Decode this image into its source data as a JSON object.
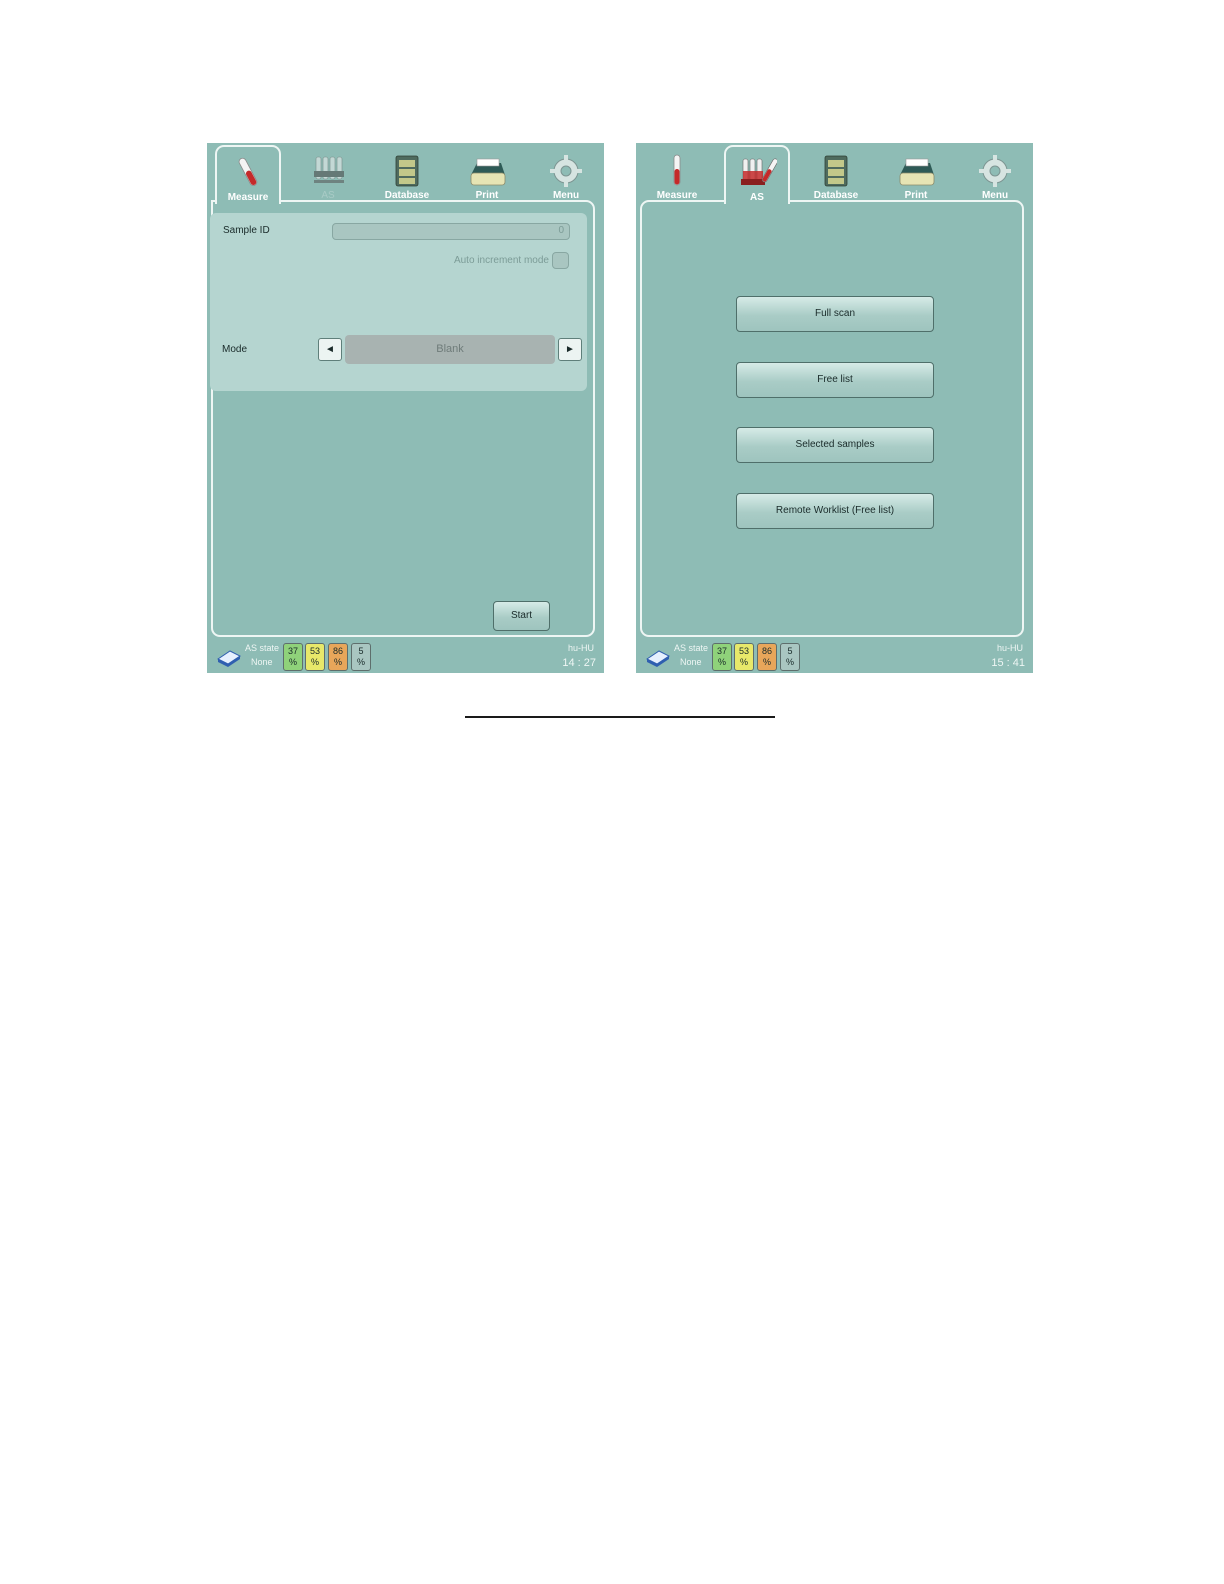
{
  "tabs": {
    "measure": "Measure",
    "as": "AS",
    "database": "Database",
    "print": "Print",
    "menu": "Menu"
  },
  "left_screen": {
    "active_tab": "Measure",
    "sample_id_label": "Sample ID",
    "sample_id_value": "0",
    "auto_increment_label": "Auto increment mode",
    "mode_label": "Mode",
    "mode_value": "Blank",
    "start_button": "Start",
    "status": {
      "as_state_label": "AS state",
      "as_state_value": "None",
      "locale": "hu-HU",
      "time": "14 : 27"
    }
  },
  "right_screen": {
    "active_tab": "AS",
    "buttons": [
      "Full scan",
      "Free list",
      "Selected samples",
      "Remote Worklist (Free list)"
    ],
    "status": {
      "as_state_label": "AS state",
      "as_state_value": "None",
      "locale": "hu-HU",
      "time": "15 : 41"
    }
  },
  "reagent_levels": [
    {
      "value": "37",
      "unit": "%",
      "color": "#8fd27a"
    },
    {
      "value": "53",
      "unit": "%",
      "color": "#e8e86a"
    },
    {
      "value": "86",
      "unit": "%",
      "color": "#e8a65a"
    },
    {
      "value": "5",
      "unit": "%",
      "color": "#a9c6c1"
    }
  ],
  "colors": {
    "screen_background": "#8ebcb5",
    "panel_background": "#b5d5d0",
    "frame_line": "#eef6f4"
  },
  "icons": {
    "measure": "test-tube-icon",
    "as": "sample-rack-icon",
    "database": "filing-cabinet-icon",
    "print": "printer-icon",
    "menu": "gear-icon",
    "status": "manual-book-icon"
  }
}
